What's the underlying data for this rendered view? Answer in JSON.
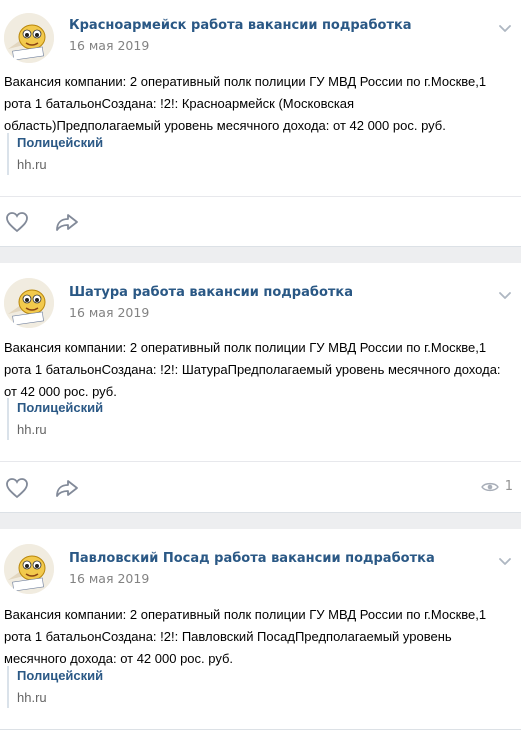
{
  "posts": [
    {
      "author": "Красноармейск работа вакансии подработка",
      "date": "16 мая 2019",
      "text": "Вакансия компании: 2 оперативный полк полиции ГУ МВД России по г.Москве,1 рота 1 батальонСоздана: !2!: Красноармейск (Московская область)Предполагаемый уровень месячного дохода: от 42 000 рос. руб.",
      "link_title": "Полицейский",
      "link_domain": "hh.ru",
      "views": ""
    },
    {
      "author": "Шатура работа вакансии подработка",
      "date": "16 мая 2019",
      "text": "Вакансия компании: 2 оперативный полк полиции ГУ МВД России по г.Москве,1 рота 1 батальонСоздана: !2!: ШатураПредполагаемый уровень месячного дохода: от 42 000 рос. руб.",
      "link_title": "Полицейский",
      "link_domain": "hh.ru",
      "views": "1"
    },
    {
      "author": "Павловский Посад работа вакансии подработка",
      "date": "16 мая 2019",
      "text": "Вакансия компании: 2 оперативный полк полиции ГУ МВД России по г.Москве,1 рота 1 батальонСоздана: !2!: Павловский ПосадПредполагаемый уровень месячного дохода: от 42 000 рос. руб.",
      "link_title": "Полицейский",
      "link_domain": "hh.ru",
      "views": ""
    }
  ],
  "icons": {
    "like": "heart-icon",
    "share": "share-arrow-icon",
    "views": "eye-icon",
    "menu": "chevron-down-icon"
  },
  "colors": {
    "link": "#2a5885",
    "secondary": "#828282",
    "background": "#edeef0"
  }
}
